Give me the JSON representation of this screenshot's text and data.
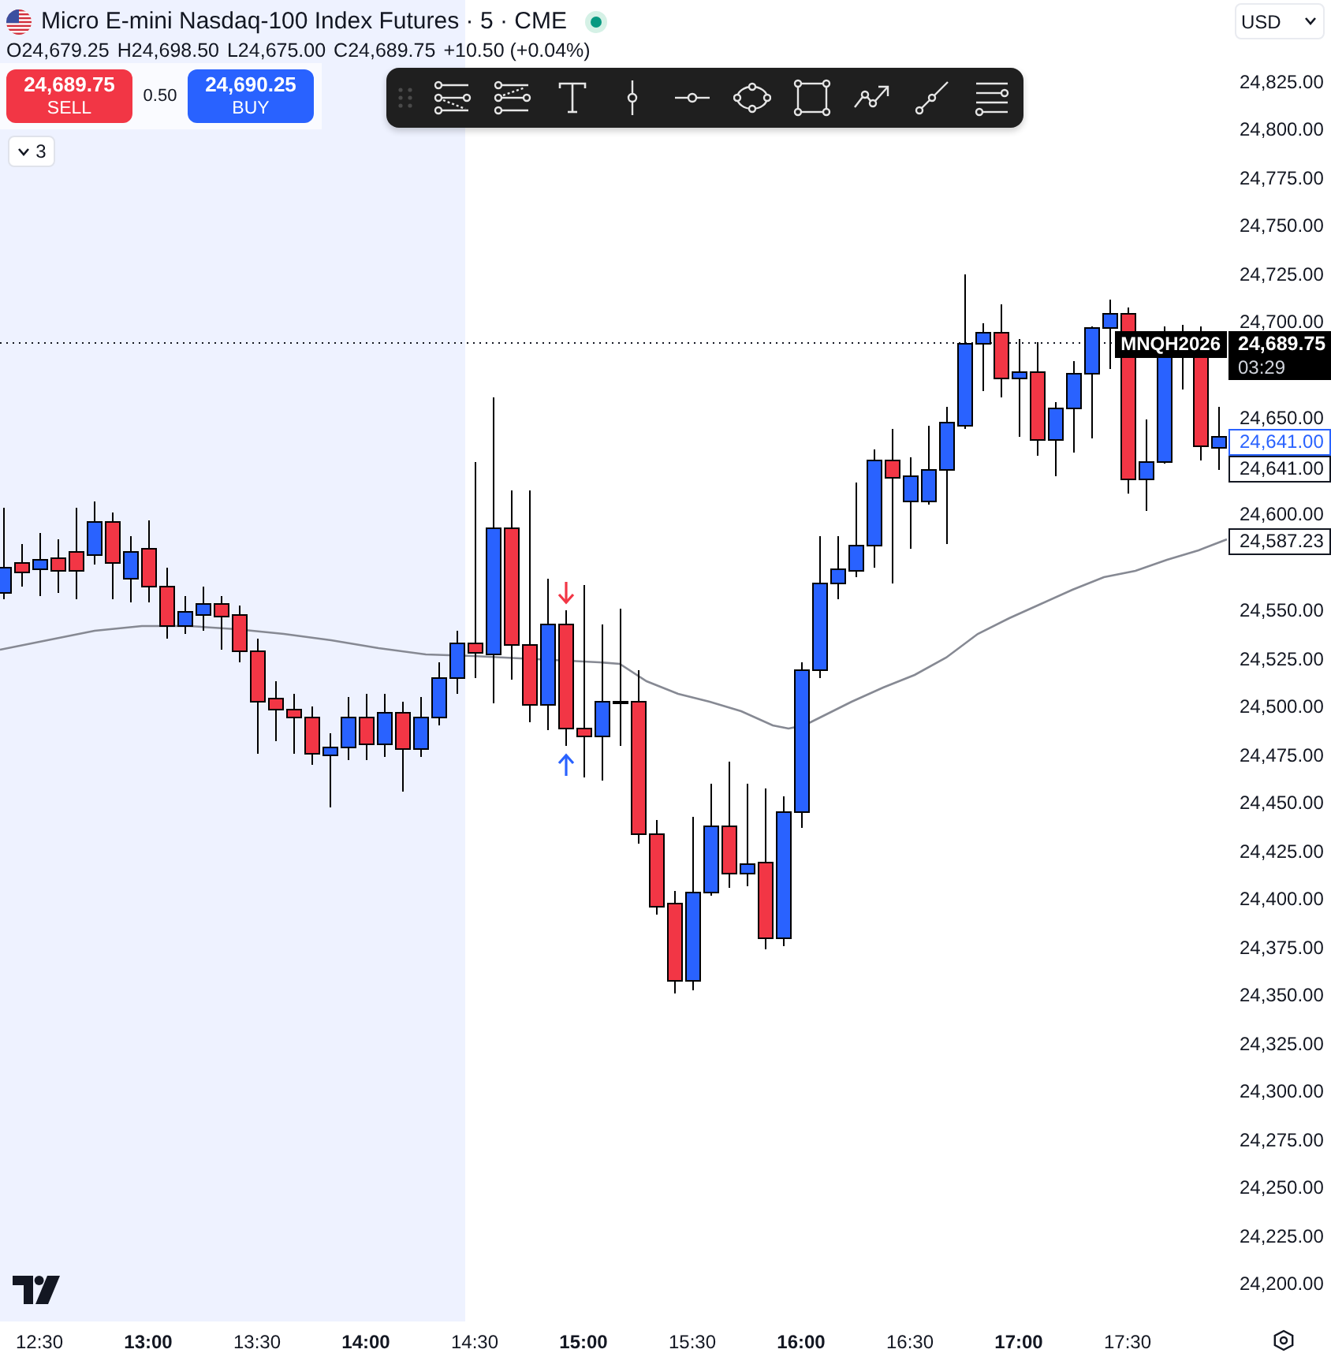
{
  "header": {
    "title": "Micro E-mini Nasdaq-100 Index Futures · 5 · CME",
    "market_open": true,
    "ohlc": [
      "O24,679.25",
      "H24,698.50",
      "L24,675.00",
      "C24,689.75",
      "+10.50 (+0.04%)"
    ]
  },
  "trade": {
    "sell": {
      "price": "24,689.75",
      "label": "SELL"
    },
    "spread": "0.50",
    "buy": {
      "price": "24,690.25",
      "label": "BUY"
    }
  },
  "indicators": {
    "count": "3",
    "expanded": false
  },
  "currency": "USD",
  "price_axis": [
    "24,825.00",
    "24,800.00",
    "24,775.00",
    "24,750.00",
    "24,725.00",
    "24,700.00",
    "24,650.00",
    "24,600.00",
    "24,550.00",
    "24,525.00",
    "24,500.00",
    "24,475.00",
    "24,450.00",
    "24,425.00",
    "24,400.00",
    "24,375.00",
    "24,350.00",
    "24,325.00",
    "24,300.00",
    "24,275.00",
    "24,250.00",
    "24,225.00",
    "24,200.00"
  ],
  "price_markers": [
    {
      "kind": "tag",
      "text": "MNQH2026"
    },
    {
      "kind": "filled",
      "text": "24,689.75",
      "countdown": "03:29"
    },
    {
      "kind": "outline",
      "text": "24,641.00",
      "color": "#2962ff"
    },
    {
      "kind": "outline",
      "text": "24,641.00",
      "color": "#131722"
    },
    {
      "kind": "outline",
      "text": "24,587.23",
      "color": "#131722"
    }
  ],
  "time_axis": [
    {
      "text": "12:30",
      "major": false
    },
    {
      "text": "13:00",
      "major": true
    },
    {
      "text": "13:30",
      "major": false
    },
    {
      "text": "14:00",
      "major": true
    },
    {
      "text": "14:30",
      "major": false
    },
    {
      "text": "15:00",
      "major": true
    },
    {
      "text": "15:30",
      "major": false
    },
    {
      "text": "16:00",
      "major": true
    },
    {
      "text": "16:30",
      "major": false
    },
    {
      "text": "17:00",
      "major": true
    },
    {
      "text": "17:30",
      "major": false
    }
  ]
}
